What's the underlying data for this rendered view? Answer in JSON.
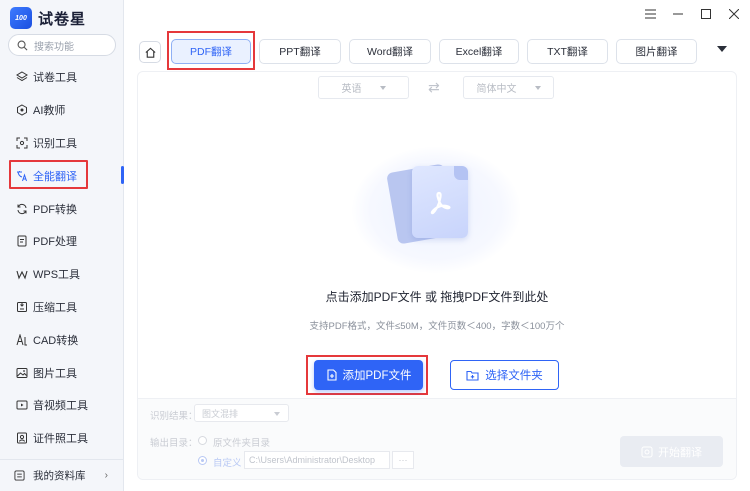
{
  "app": {
    "logo_badge": "100",
    "name": "试卷星"
  },
  "search": {
    "placeholder": "搜索功能"
  },
  "sidebar": {
    "items": [
      {
        "label": "试卷工具",
        "icon": "layers-icon"
      },
      {
        "label": "AI教师",
        "icon": "ai-teacher-icon"
      },
      {
        "label": "识别工具",
        "icon": "scan-icon"
      },
      {
        "label": "全能翻译",
        "icon": "translate-icon",
        "active": true
      },
      {
        "label": "PDF转换",
        "icon": "convert-icon"
      },
      {
        "label": "PDF处理",
        "icon": "pdf-process-icon"
      },
      {
        "label": "WPS工具",
        "icon": "wps-icon"
      },
      {
        "label": "压缩工具",
        "icon": "compress-icon"
      },
      {
        "label": "CAD转换",
        "icon": "cad-icon"
      },
      {
        "label": "图片工具",
        "icon": "image-icon"
      },
      {
        "label": "音视频工具",
        "icon": "media-icon"
      },
      {
        "label": "证件照工具",
        "icon": "id-photo-icon"
      }
    ],
    "library_label": "我的资料库"
  },
  "tabs": [
    {
      "label": "PDF翻译",
      "active": true
    },
    {
      "label": "PPT翻译"
    },
    {
      "label": "Word翻译"
    },
    {
      "label": "Excel翻译"
    },
    {
      "label": "TXT翻译"
    },
    {
      "label": "图片翻译"
    }
  ],
  "lang": {
    "source": "英语",
    "target": "简体中文"
  },
  "drop": {
    "title": "点击添加PDF文件 或 拖拽PDF文件到此处",
    "subtitle": "支持PDF格式，文件≤50M，文件页数＜400，字数＜100万个"
  },
  "buttons": {
    "add": "添加PDF文件",
    "folder": "选择文件夹",
    "start": "开始翻译"
  },
  "options": {
    "result_label": "识别结果：",
    "result_value": "图文混排",
    "output_label": "输出目录：",
    "source_dir": "原文件夹目录",
    "custom": "自定义",
    "path": "C:\\Users\\Administrator\\Desktop",
    "browse": "···"
  },
  "colors": {
    "accent": "#2f64f6",
    "highlight": "#e5383b"
  }
}
